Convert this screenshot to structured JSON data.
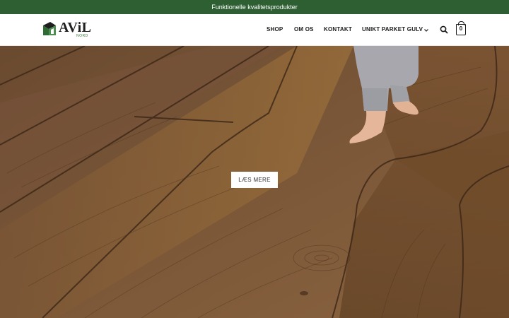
{
  "topbar": {
    "text": "Funktionelle kvalitetsprodukter"
  },
  "logo": {
    "main": "AViL",
    "sub": "NORD"
  },
  "nav": {
    "items": [
      {
        "label": "SHOP"
      },
      {
        "label": "OM OS"
      },
      {
        "label": "KONTAKT"
      },
      {
        "label": "UNIKT PARKET GULV"
      }
    ],
    "cart_count": "0"
  },
  "hero": {
    "button_label": "LÆS MERE"
  },
  "colors": {
    "topbar": "#2e5f33",
    "wood": "#7b5737",
    "brand_green": "#3a7a3f"
  },
  "icons": [
    "logo-mark-icon",
    "chevron-down-icon",
    "search-icon",
    "cart-icon"
  ]
}
